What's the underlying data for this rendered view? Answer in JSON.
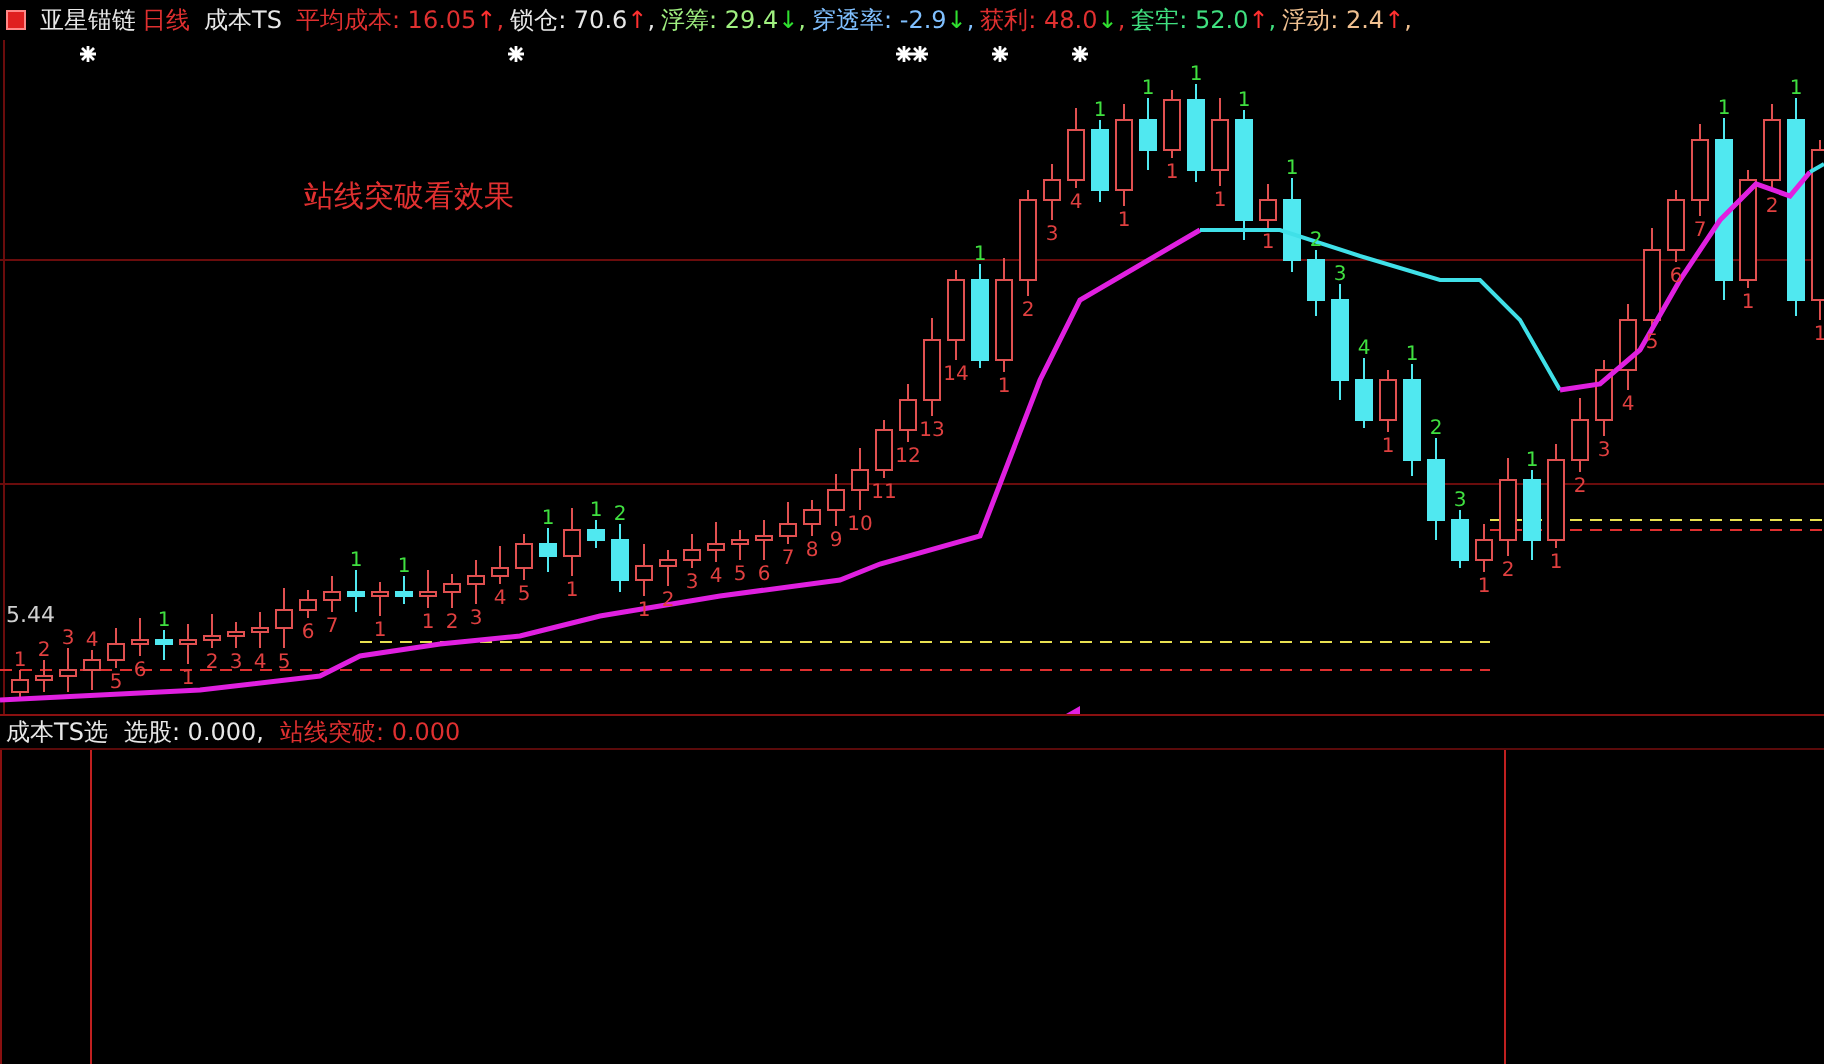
{
  "header": {
    "stock": "亚星锚链",
    "period": "日线",
    "indicator": "成本TS",
    "values": [
      {
        "label": "平均成本:",
        "value": "16.05",
        "arrow": "↑",
        "rising": true,
        "separator": ",",
        "color": "#e03030"
      },
      {
        "label": "锁仓:",
        "value": "70.6",
        "arrow": "↑",
        "rising": true,
        "separator": ",",
        "color": "#e8e8e8"
      },
      {
        "label": "浮筹:",
        "value": "29.4",
        "arrow": "↓",
        "rising": false,
        "separator": ",",
        "color": "#a0f080"
      },
      {
        "label": "穿透率:",
        "value": "-2.9",
        "arrow": "↓",
        "rising": false,
        "separator": ",",
        "color": "#80c0ff"
      },
      {
        "label": "获利:",
        "value": "48.0",
        "arrow": "↓",
        "rising": false,
        "separator": ",",
        "color": "#e03030"
      },
      {
        "label": "套牢:",
        "value": "52.0",
        "arrow": "↑",
        "rising": true,
        "separator": ",",
        "color": "#40e080"
      },
      {
        "label": "浮动:",
        "value": "2.4",
        "arrow": "↑",
        "rising": true,
        "separator": ",",
        "color": "#f0c090"
      }
    ]
  },
  "chart": {
    "caption": "站线突破看效果",
    "price_tag": "5.44",
    "counts": [
      {
        "text": "1",
        "color": "#e04040"
      },
      {
        "text": "2",
        "color": "#e04040"
      },
      {
        "text": "3",
        "color": "#e04040"
      },
      {
        "text": "4",
        "color": "#e04040"
      },
      {
        "text": "5",
        "color": "#e04040"
      },
      {
        "text": "6",
        "color": "#e04040"
      },
      {
        "text": "1",
        "color": "#40e040"
      },
      {
        "text": "1",
        "color": "#e04040"
      },
      {
        "text": "2",
        "color": "#e04040"
      },
      {
        "text": "3",
        "color": "#e04040"
      },
      {
        "text": "4",
        "color": "#e04040"
      },
      {
        "text": "5",
        "color": "#e04040"
      },
      {
        "text": "6",
        "color": "#e04040"
      },
      {
        "text": "7",
        "color": "#e04040"
      },
      {
        "text": "1",
        "color": "#40e040"
      },
      {
        "text": "1",
        "color": "#e04040"
      },
      {
        "text": "1",
        "color": "#40e040"
      },
      {
        "text": "1",
        "color": "#e04040"
      },
      {
        "text": "2",
        "color": "#e04040"
      },
      {
        "text": "3",
        "color": "#e04040"
      },
      {
        "text": "4",
        "color": "#e04040"
      },
      {
        "text": "5",
        "color": "#e04040"
      },
      {
        "text": "1",
        "color": "#40e040"
      },
      {
        "text": "1",
        "color": "#e04040"
      },
      {
        "text": "1",
        "color": "#40e040"
      },
      {
        "text": "2",
        "color": "#40e040"
      },
      {
        "text": "1",
        "color": "#e04040"
      },
      {
        "text": "2",
        "color": "#e04040"
      },
      {
        "text": "3",
        "color": "#e04040"
      },
      {
        "text": "4",
        "color": "#e04040"
      },
      {
        "text": "5",
        "color": "#e04040"
      },
      {
        "text": "6",
        "color": "#e04040"
      },
      {
        "text": "7",
        "color": "#e04040"
      },
      {
        "text": "8",
        "color": "#e04040"
      },
      {
        "text": "9",
        "color": "#e04040"
      },
      {
        "text": "10",
        "color": "#e04040"
      },
      {
        "text": "11",
        "color": "#e04040"
      },
      {
        "text": "12",
        "color": "#e04040"
      },
      {
        "text": "13",
        "color": "#e04040"
      },
      {
        "text": "14",
        "color": "#e04040"
      },
      {
        "text": "1",
        "color": "#40e040"
      },
      {
        "text": "1",
        "color": "#e04040"
      },
      {
        "text": "2",
        "color": "#e04040"
      },
      {
        "text": "3",
        "color": "#e04040"
      },
      {
        "text": "4",
        "color": "#e04040"
      },
      {
        "text": "1",
        "color": "#40e040"
      },
      {
        "text": "1",
        "color": "#e04040"
      },
      {
        "text": "1",
        "color": "#40e040"
      },
      {
        "text": "1",
        "color": "#e04040"
      },
      {
        "text": "1",
        "color": "#40e040"
      },
      {
        "text": "1",
        "color": "#e04040"
      },
      {
        "text": "1",
        "color": "#40e040"
      },
      {
        "text": "1",
        "color": "#e04040"
      },
      {
        "text": "1",
        "color": "#40e040"
      },
      {
        "text": "2",
        "color": "#40e040"
      },
      {
        "text": "3",
        "color": "#40e040"
      },
      {
        "text": "4",
        "color": "#40e040"
      },
      {
        "text": "1",
        "color": "#e04040"
      },
      {
        "text": "1",
        "color": "#40e040"
      },
      {
        "text": "2",
        "color": "#40e040"
      },
      {
        "text": "3",
        "color": "#40e040"
      },
      {
        "text": "1",
        "color": "#e04040"
      },
      {
        "text": "2",
        "color": "#e04040"
      },
      {
        "text": "1",
        "color": "#40e040"
      },
      {
        "text": "1",
        "color": "#e04040"
      },
      {
        "text": "2",
        "color": "#e04040"
      },
      {
        "text": "3",
        "color": "#e04040"
      },
      {
        "text": "4",
        "color": "#e04040"
      },
      {
        "text": "5",
        "color": "#e04040"
      },
      {
        "text": "6",
        "color": "#e04040"
      },
      {
        "text": "7",
        "color": "#e04040"
      },
      {
        "text": "1",
        "color": "#40e040"
      },
      {
        "text": "1",
        "color": "#e04040"
      },
      {
        "text": "2",
        "color": "#e04040"
      },
      {
        "text": "1",
        "color": "#40e040"
      },
      {
        "text": "1",
        "color": "#e04040"
      }
    ]
  },
  "sub_panel": {
    "name": "成本TS选",
    "values": [
      {
        "label": "选股:",
        "value": "0.000,",
        "color": "#e8e8e8"
      },
      {
        "label": "站线突破:",
        "value": "0.000",
        "color": "#e03030"
      }
    ]
  }
}
